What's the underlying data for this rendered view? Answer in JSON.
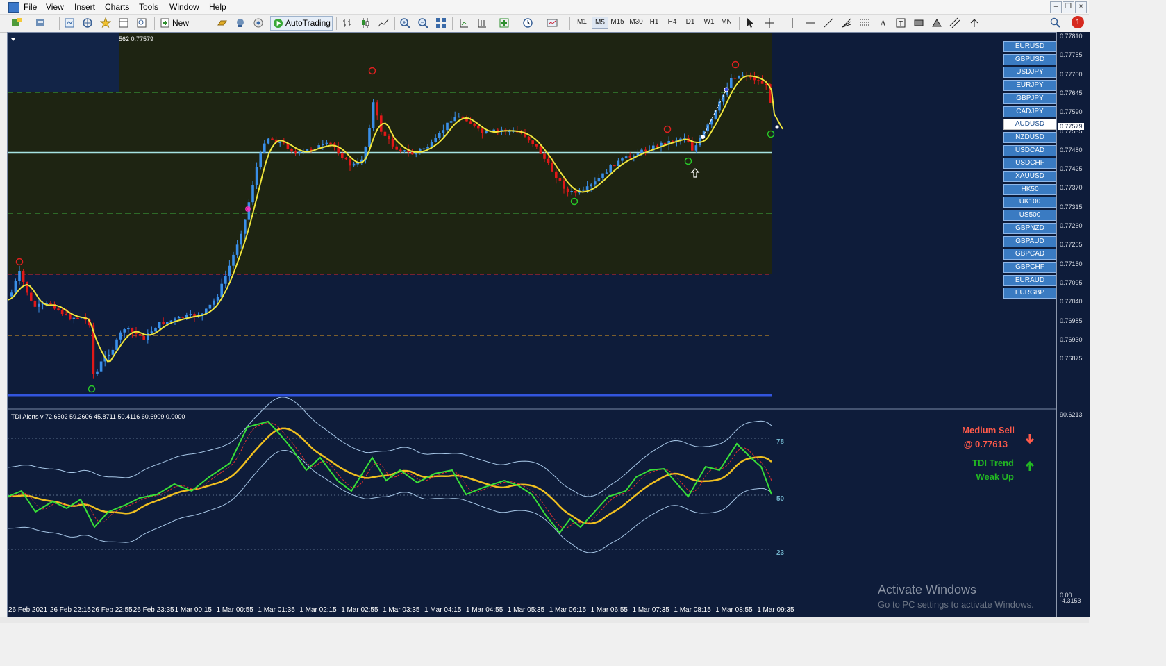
{
  "menu": [
    "File",
    "View",
    "Insert",
    "Charts",
    "Tools",
    "Window",
    "Help"
  ],
  "toolbar": {
    "new_order": "New Order",
    "autotrading": "AutoTrading",
    "timeframes": [
      "M1",
      "M5",
      "M15",
      "M30",
      "H1",
      "H4",
      "D1",
      "W1",
      "MN"
    ],
    "active_timeframe": "M5"
  },
  "notifications_badge": "1",
  "chart": {
    "header": "562 0.77579",
    "price_labels": [
      "0.77810",
      "0.77755",
      "0.77700",
      "0.77645",
      "0.77590",
      "0.77535",
      "0.77480",
      "0.77425",
      "0.77370",
      "0.77315",
      "0.77260",
      "0.77205",
      "0.77150",
      "0.77095",
      "0.77040",
      "0.76985",
      "0.76930",
      "0.76875"
    ],
    "current_price": "0.77579",
    "symbols": [
      "EURUSD",
      "GBPUSD",
      "USDJPY",
      "EURJPY",
      "GBPJPY",
      "CADJPY",
      "AUDUSD",
      "NZDUSD",
      "USDCAD",
      "USDCHF",
      "XAUUSD",
      "HK50",
      "UK100",
      "US500",
      "GBPNZD",
      "GBPAUD",
      "GBPCAD",
      "GBPCHF",
      "EURAUD",
      "EURGBP"
    ],
    "active_symbol": "AUDUSD",
    "time_labels": [
      "26 Feb 2021",
      "26 Feb 22:15",
      "26 Feb 22:55",
      "26 Feb 23:35",
      "1 Mar 00:15",
      "1 Mar 00:55",
      "1 Mar 01:35",
      "1 Mar 02:15",
      "1 Mar 02:55",
      "1 Mar 03:35",
      "1 Mar 04:15",
      "1 Mar 04:55",
      "1 Mar 05:35",
      "1 Mar 06:15",
      "1 Mar 06:55",
      "1 Mar 07:35",
      "1 Mar 08:15",
      "1 Mar 08:55",
      "1 Mar 09:35"
    ]
  },
  "indicator": {
    "label": "TDI Alerts v 72.6502 59.2606 45.8711 50.4116 60.6909 0.0000",
    "scale_top": "90.6213",
    "scale_bottom_a": "0.00",
    "scale_bottom_b": "-4.3153",
    "levels": [
      "78",
      "50",
      "23"
    ],
    "signal_line1": "Medium Sell",
    "signal_line2": "@ 0.77613",
    "trend_line1": "TDI Trend",
    "trend_line2": "Weak Up"
  },
  "watermark": {
    "title": "Activate Windows",
    "subtitle": "Go to PC settings to activate Windows."
  },
  "colors": {
    "chart_bg": "#0e1c3a",
    "zone_bg": "#1e2412",
    "bull": "#3a8fe8",
    "bear": "#e01818",
    "ma": "#f0e63c",
    "tdi_rsi": "#38e038",
    "tdi_signal": "#f0c020",
    "band": "#a8c8e8",
    "support": "#3355dd",
    "sell_text": "#ff5a4a",
    "trend_text": "#22b822"
  }
}
